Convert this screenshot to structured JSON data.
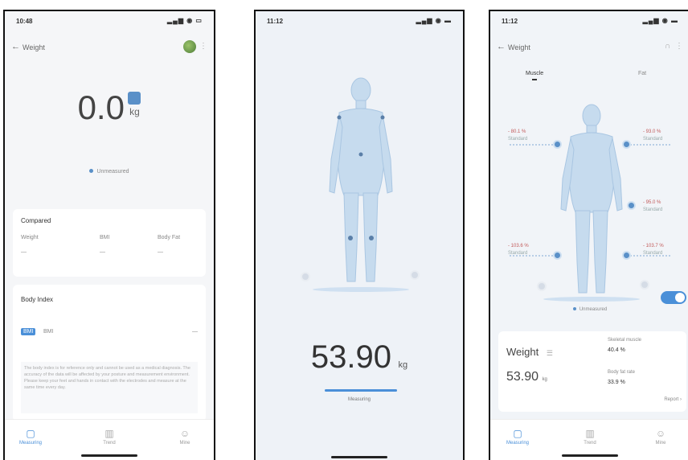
{
  "screen1": {
    "time": "10:48",
    "title": "Weight",
    "weight_value": "0.0",
    "weight_unit": "kg",
    "status_text": "Unmeasured",
    "compared": {
      "title": "Compared",
      "columns": [
        "Weight",
        "BMI",
        "Body Fat"
      ],
      "values": [
        "—",
        "—",
        "—"
      ]
    },
    "body_index": {
      "title": "Body Index",
      "bmi_badge": "BMI",
      "bmi_label": "BMI",
      "bmi_value": "—",
      "note": "The body index is for reference only and cannot be used as a medical diagnosis. The accuracy of the data will be affected by your posture and measurement environment. Please keep your feet and hands in contact with the electrodes and measure at the same time every day."
    },
    "tabs": [
      "Measuring",
      "Trend",
      "Mine"
    ]
  },
  "screen2": {
    "time": "11:12",
    "weight_value": "53.90",
    "weight_unit": "kg",
    "status_text": "Measuring"
  },
  "screen3": {
    "time": "11:12",
    "title": "Weight",
    "segment_tabs": [
      "Muscle",
      "Fat"
    ],
    "labels": {
      "left_arm": {
        "value": "- 80.1 %",
        "status": "Standard"
      },
      "right_arm": {
        "value": "- 93.0 %",
        "status": "Standard"
      },
      "trunk": {
        "value": "- 95.0 %",
        "status": "Standard"
      },
      "left_leg": {
        "value": "- 103.6 %",
        "status": "Standard"
      },
      "right_leg": {
        "value": "- 103.7 %",
        "status": "Standard"
      }
    },
    "toggle_on": true,
    "status_text": "Unmeasured",
    "weight_title": "Weight",
    "weight_value": "53.90",
    "weight_unit": "kg",
    "skeletal_muscle": {
      "label": "Skeletal muscle",
      "value": "40.4 %"
    },
    "body_fat_rate": {
      "label": "Body fat rate",
      "value": "33.9 %"
    },
    "report_link": "Report",
    "tabs": [
      "Measuring",
      "Trend",
      "Mine"
    ]
  },
  "colors": {
    "accent": "#4a8fd8",
    "body": "#c6dbee"
  },
  "icons": [
    "back-arrow-icon",
    "more-icon",
    "measuring-icon",
    "trend-icon",
    "mine-icon"
  ]
}
